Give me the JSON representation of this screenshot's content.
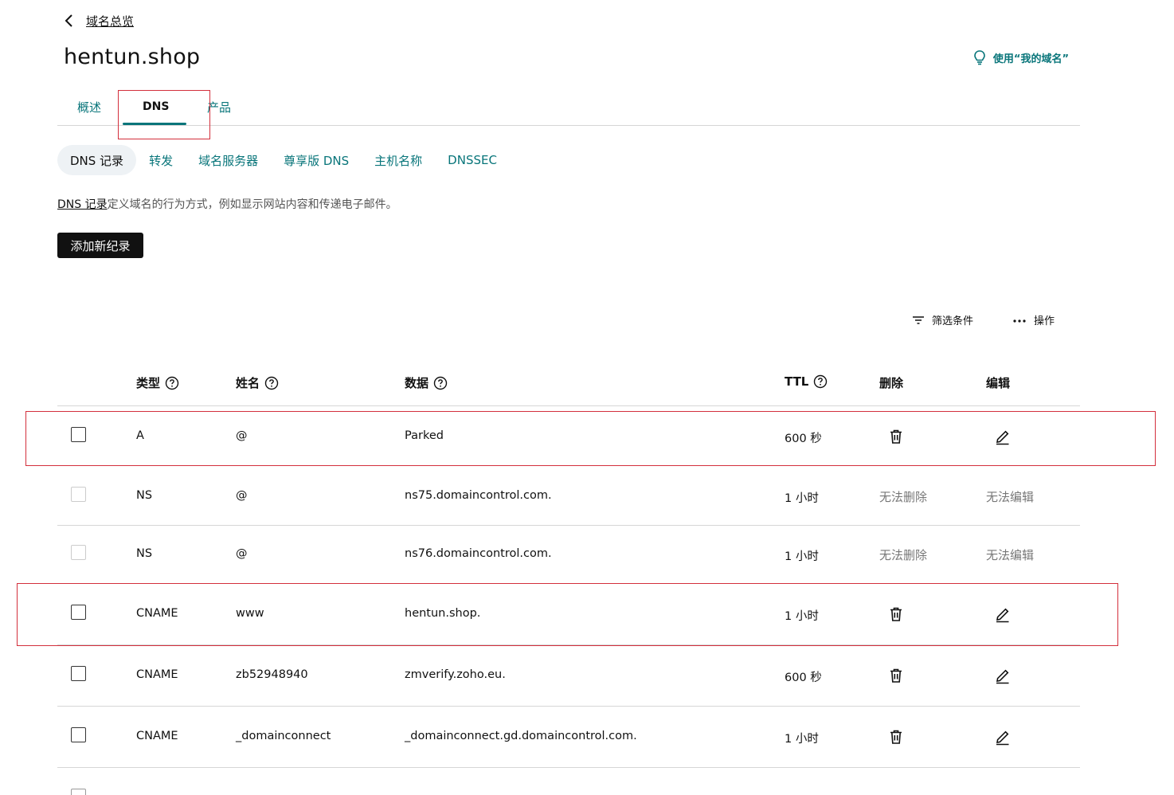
{
  "header": {
    "back_label": "域名总览",
    "title": "hentun.shop",
    "help_label": "使用“我的域名”"
  },
  "tabs": [
    {
      "label": "概述",
      "active": false
    },
    {
      "label": "DNS",
      "active": true
    },
    {
      "label": "产品",
      "active": false
    }
  ],
  "subnav": [
    {
      "label": "DNS 记录",
      "active": true
    },
    {
      "label": "转发",
      "active": false
    },
    {
      "label": "域名服务器",
      "active": false
    },
    {
      "label": "尊享版 DNS",
      "active": false
    },
    {
      "label": "主机名称",
      "active": false
    },
    {
      "label": "DNSSEC",
      "active": false
    }
  ],
  "description": {
    "link": "DNS 记录",
    "text": "定义域名的行为方式，例如显示网站内容和传递电子邮件。"
  },
  "add_button": "添加新纪录",
  "toolbar": {
    "filter_label": "筛选条件",
    "actions_label": "操作"
  },
  "table": {
    "headers": {
      "type": "类型",
      "name": "姓名",
      "data": "数据",
      "ttl": "TTL",
      "delete": "删除",
      "edit": "编辑"
    },
    "rows": [
      {
        "type": "A",
        "name": "@",
        "data": "Parked",
        "ttl": "600 秒",
        "deletable": true,
        "editable": true
      },
      {
        "type": "NS",
        "name": "@",
        "data": "ns75.domaincontrol.com.",
        "ttl": "1 小时",
        "deletable": false,
        "editable": false,
        "delete_text": "无法删除",
        "edit_text": "无法编辑"
      },
      {
        "type": "NS",
        "name": "@",
        "data": "ns76.domaincontrol.com.",
        "ttl": "1 小时",
        "deletable": false,
        "editable": false,
        "delete_text": "无法删除",
        "edit_text": "无法编辑"
      },
      {
        "type": "CNAME",
        "name": "www",
        "data": "hentun.shop.",
        "ttl": "1 小时",
        "deletable": true,
        "editable": true
      },
      {
        "type": "CNAME",
        "name": "zb52948940",
        "data": "zmverify.zoho.eu.",
        "ttl": "600 秒",
        "deletable": true,
        "editable": true
      },
      {
        "type": "CNAME",
        "name": "_domainconnect",
        "data": "_domainconnect.gd.domaincontrol.com.",
        "ttl": "1 小时",
        "deletable": true,
        "editable": true
      }
    ]
  },
  "colors": {
    "accent": "#08757a",
    "highlight": "#d32f3c"
  }
}
